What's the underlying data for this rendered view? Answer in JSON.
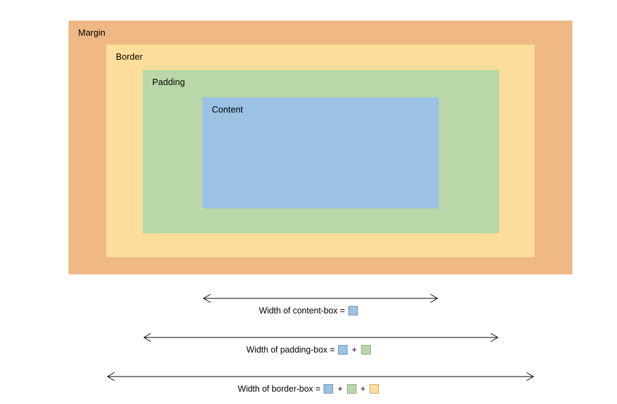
{
  "boxes": {
    "margin": {
      "label": "Margin",
      "color": "#efb884"
    },
    "border": {
      "label": "Border",
      "color": "#fcdd9b"
    },
    "padding": {
      "label": "Padding",
      "color": "#b9d7a8"
    },
    "content": {
      "label": "Content",
      "color": "#9bc1e3"
    }
  },
  "legend": {
    "row1": {
      "text": "Width of content-box =",
      "swatches": [
        "content"
      ]
    },
    "row2": {
      "text": "Width of padding-box =",
      "swatches": [
        "content",
        "padding"
      ]
    },
    "row3": {
      "text": "Width of border-box =",
      "swatches": [
        "content",
        "padding",
        "border"
      ]
    }
  },
  "swatch_colors": {
    "content": "#9bc1e3",
    "padding": "#b9d7a8",
    "border": "#fcdd9b"
  }
}
